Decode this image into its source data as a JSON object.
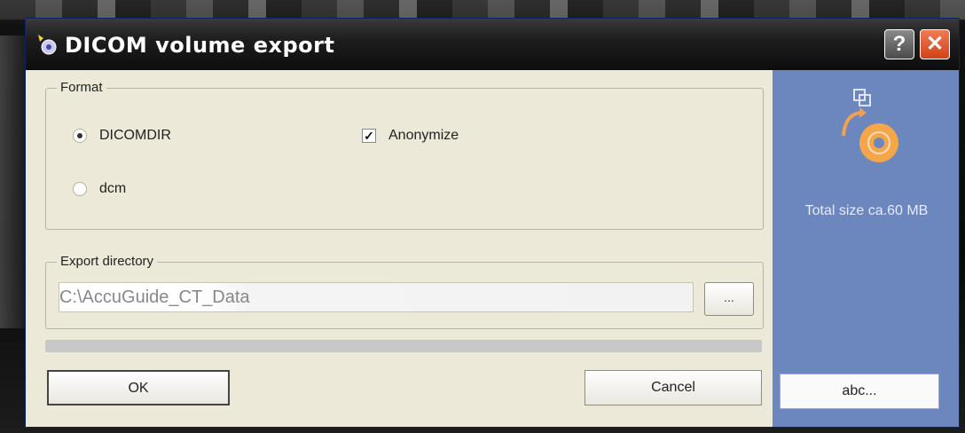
{
  "window": {
    "title": "DICOM volume export",
    "help_label": "?",
    "close_label": "✕"
  },
  "format": {
    "legend": "Format",
    "options": [
      {
        "label": "DICOMDIR",
        "selected": true
      },
      {
        "label": "dcm",
        "selected": false
      }
    ],
    "anonymize": {
      "label": "Anonymize",
      "checked": true,
      "mark": "✓"
    }
  },
  "export_directory": {
    "legend": "Export directory",
    "value": "C:\\AccuGuide_CT_Data",
    "browse_label": "..."
  },
  "progress": {
    "value": 0
  },
  "buttons": {
    "ok": "OK",
    "cancel": "Cancel",
    "abc": "abc..."
  },
  "side_panel": {
    "total_size": "Total size ca.60 MB",
    "icon": "export-disc-icon",
    "color": "#6c86be"
  }
}
